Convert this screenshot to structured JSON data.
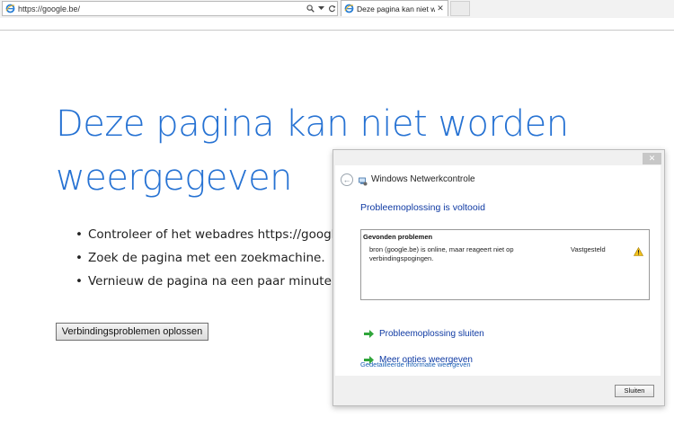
{
  "browser": {
    "address": "https://google.be/",
    "address_buttons": {
      "search_icon": "search-icon",
      "dropdown_icon": "chevron-down-icon",
      "refresh_icon": "refresh-icon"
    },
    "tab_title": "Deze pagina kan niet worde...",
    "tab_close": "✕",
    "accent_color": "#2672d3"
  },
  "page": {
    "title": "Deze pagina kan niet worden weergegeven",
    "suggestions": [
      "Controleer of het webadres https://google.be j",
      "Zoek de pagina met een zoekmachine.",
      "Vernieuw de pagina na een paar minuten."
    ],
    "fix_button": "Verbindingsproblemen oplossen"
  },
  "dialog": {
    "window_title": "Windows Netwerkcontrole",
    "close_glyph": "✕",
    "back_glyph": "←",
    "heading": "Probleemoplossing is voltooid",
    "problems_header": "Gevonden problemen",
    "problem": {
      "description": "bron (google.be) is online, maar reageert niet op verbindingspogingen.",
      "status": "Vastgesteld",
      "icon": "warning-icon"
    },
    "commands": [
      "Probleemoplossing sluiten",
      "Meer opties weergeven"
    ],
    "details_link": "Gedetailleerde informatie weergeven",
    "close_button": "Sluiten",
    "heading_color": "#0f3aa3"
  }
}
